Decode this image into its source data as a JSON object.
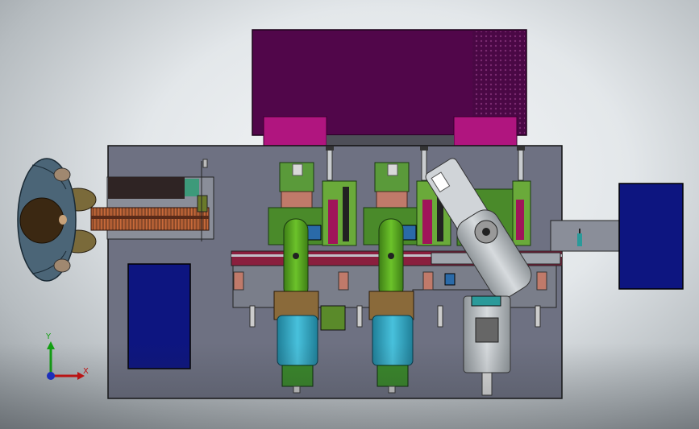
{
  "viewport": {
    "background": "#e6e9ec"
  },
  "colors": {
    "base_plate": "#6e7182",
    "cabinet": "#51064a",
    "cabinet_feet": "#b0157f",
    "panel_blue": "#0d1580",
    "motor_cyan": "#2fa7c2",
    "motor_green": "#4e9a1c",
    "conveyor": "#8a1f3e",
    "operator_coat": "#4b6577",
    "operator_hair": "#3b2812"
  },
  "triad": {
    "x_label": "X",
    "y_label": "Y",
    "x_color": "#d01010",
    "y_color": "#12a012",
    "z_color": "#1a2fd0"
  }
}
